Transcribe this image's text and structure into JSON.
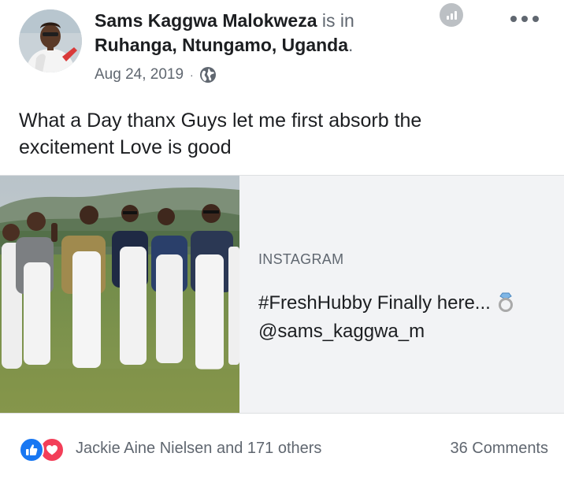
{
  "post": {
    "author": "Sams Kaggwa Malokweza",
    "is_in": "is in",
    "location": "Ruhanga, Ntungamo, Uganda",
    "period": ".",
    "date": "Aug 24, 2019",
    "separator": "·",
    "privacy_icon": "globe-icon",
    "text_line1": "What a Day thanx Guys let me first absorb the",
    "text_line2": "excitement Love is good"
  },
  "link_card": {
    "source": "INSTAGRAM",
    "title_line1": "#FreshHubby Finally here...",
    "title_line2": "@sams_kaggwa_m",
    "emoji": "ring-icon"
  },
  "engagement": {
    "reaction_icons": [
      "like-icon",
      "love-icon"
    ],
    "reactors": "Jackie Aine Nielsen and 171 others",
    "comments": "36 Comments"
  },
  "colors": {
    "like": "#1877f2",
    "love": "#f33e58",
    "secondary_text": "#606770",
    "card_bg": "#f2f3f5"
  }
}
